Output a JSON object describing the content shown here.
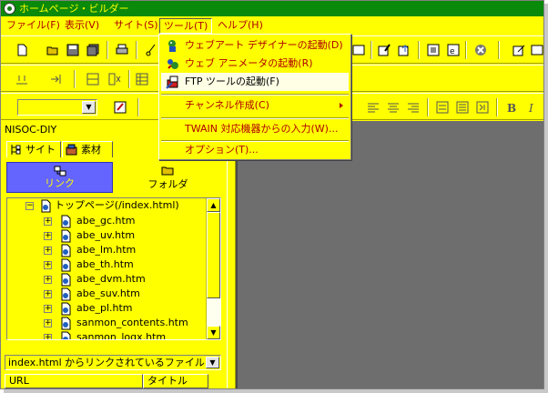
{
  "title": "ホームページ・ビルダー",
  "menu": [
    {
      "label": "ファイル(F)"
    },
    {
      "label": "表示(V)"
    },
    {
      "label": "サイト(S)"
    },
    {
      "label": "ツール(T)"
    },
    {
      "label": "ヘルプ(H)"
    }
  ],
  "tool_menu": {
    "items": [
      {
        "label": "ウェブアート デザイナーの起動(D)",
        "icon": "web-art-designer-icon"
      },
      {
        "label": "ウェブ アニメータの起動(R)",
        "icon": "web-animator-icon"
      },
      {
        "label": "FTP ツールの起動(F)",
        "icon": "ftp-tool-icon"
      }
    ],
    "channel": "チャンネル作成(C)",
    "twain": "TWAIN 対応機器からの入力(W)...",
    "options": "オプション(T)..."
  },
  "site_name": "NISOC-DIY",
  "tabs": {
    "site": "サイト",
    "material": "素材"
  },
  "panels": {
    "link": "リンク",
    "folder": "フォルダ"
  },
  "tree": {
    "root": "トップページ(/index.html)",
    "children": [
      "abe_gc.htm",
      "abe_uv.htm",
      "abe_lm.htm",
      "abe_th.htm",
      "abe_dvm.htm",
      "abe_suv.htm",
      "abe_pl.htm",
      "sanmon_contents.htm",
      "sanmon_logx.htm"
    ]
  },
  "link_filter": "index.html からリンクされているファイル",
  "columns": {
    "url": "URL",
    "title": "タイトル"
  },
  "colors": {
    "window": "#ffff00",
    "titlebar": "#0a8a0a",
    "menu_text": "#b00000",
    "workspace": "#6e6e6e",
    "link_panel": "#6464ff"
  }
}
